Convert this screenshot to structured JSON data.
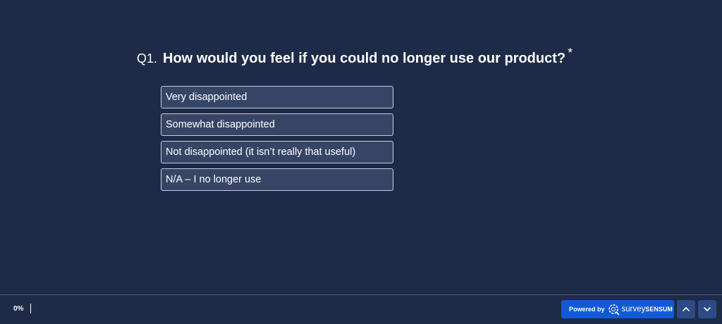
{
  "question": {
    "number": "Q1.",
    "text": "How would you feel if you could no longer use our product?",
    "required_marker": "*"
  },
  "options": [
    {
      "label": "Very disappointed"
    },
    {
      "label": "Somewhat disappointed"
    },
    {
      "label": "Not disappointed (it isn’t really that useful)"
    },
    {
      "label": "N/A – I no longer use"
    }
  ],
  "footer": {
    "progress_text": "0%",
    "powered_by": "Powered by",
    "brand_part1": "survey",
    "brand_part2": "SENSUM",
    "nav_up_icon": "chevron-up-icon",
    "nav_down_icon": "chevron-down-icon"
  },
  "colors": {
    "background": "#1d2a48",
    "option_background": "#364566",
    "option_border": "#c7cedc",
    "powered_button": "#1259d6",
    "nav_button": "#2b4a86"
  }
}
